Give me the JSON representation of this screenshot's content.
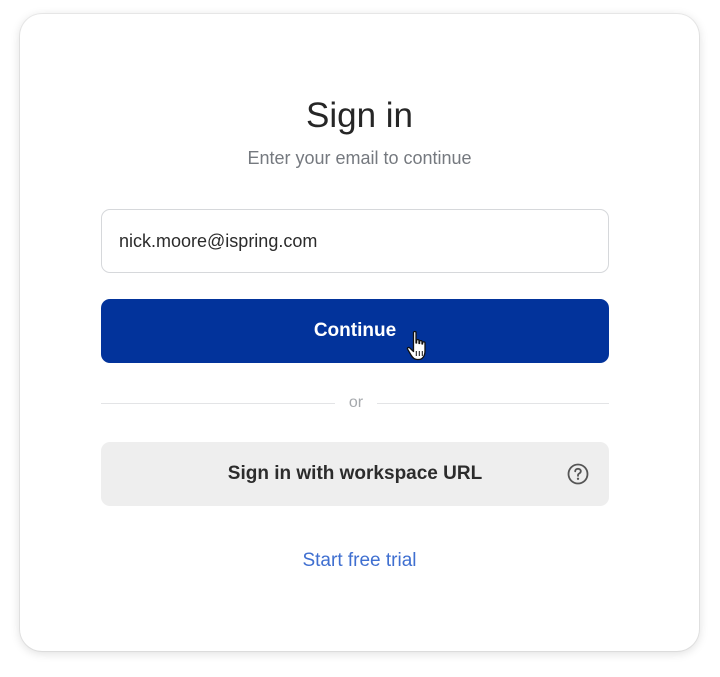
{
  "signin": {
    "title": "Sign in",
    "subtitle": "Enter your email to continue",
    "email_value": "nick.moore@ispring.com",
    "continue_label": "Continue",
    "or_label": "or",
    "workspace_label": "Sign in with workspace URL",
    "trial_label": "Start free trial"
  },
  "icons": {
    "help": "question-circle-icon",
    "cursor": "hand-pointer-cursor-icon"
  },
  "colors": {
    "primary_button": "#02339b",
    "secondary_button": "#eeeeee",
    "link": "#3f6fd0",
    "title_text": "#262626",
    "subtitle_text": "#75797f"
  }
}
